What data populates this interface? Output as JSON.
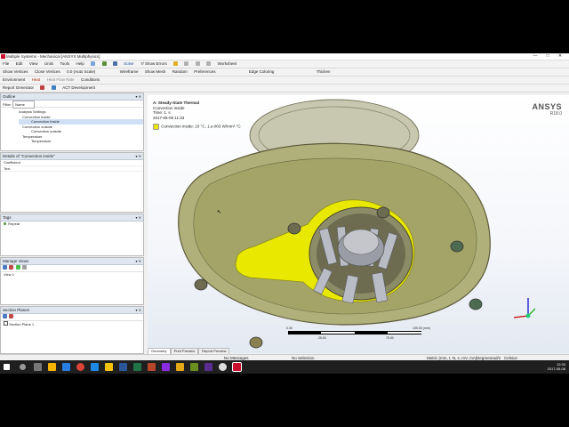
{
  "window": {
    "title": "Multiple Systems - Mechanical [ANSYS Multiphysics]",
    "controls": [
      "—",
      "□",
      "✕"
    ]
  },
  "menubar": {
    "items": [
      "File",
      "Edit",
      "View",
      "Units",
      "Tools",
      "Help"
    ],
    "solve_label": "Solve",
    "show_errors_label": "?/ Show Errors",
    "worksheet_label": "Worksheet"
  },
  "toolbar2": {
    "items": [
      "Show Vertices",
      "Close Vertices",
      "0.0 (Auto Scale)",
      "Wireframe",
      "Show Mesh",
      "Random",
      "Preferences",
      "Edge Coloring",
      "Thicken"
    ]
  },
  "toolbar3": {
    "environment_label": "Environment",
    "heat_label": "Heat",
    "heat_flow_label": "Heat Flow Rate",
    "conditions_label": "Conditions"
  },
  "toolbar4": {
    "report_label": "Report Generator",
    "act_label": "ACT Development"
  },
  "outline": {
    "title": "Outline",
    "filter_label": "Filter:",
    "filter_value": "Name",
    "tree": [
      "Analysis Settings",
      "Convection inside",
      "Convection Inside",
      "Convection outside",
      "Convection outside",
      "Temperature",
      "Temperature"
    ]
  },
  "details": {
    "title": "Details of \"Convection inside\"",
    "rows": [
      "Coefficient",
      "Text"
    ]
  },
  "tags": {
    "title": "Tags",
    "items": [
      "Repeat"
    ]
  },
  "manage_views": {
    "title": "Manage Views",
    "items": [
      "View 1"
    ]
  },
  "section_planes": {
    "title": "Section Planes",
    "items": [
      "Section Plane 1"
    ]
  },
  "viewport": {
    "analysis_title": "A: Steady-State Thermal",
    "load_name": "Convection inside",
    "time_label": "Time: 1. s",
    "date_label": "2017-05-08 11:33",
    "legend_entry": "Convection inside: 10 °C, 1.e-003 W/mm²·°C",
    "legend_color": "#e8e800",
    "logo_line1": "ANSYS",
    "logo_line2": "R18.0",
    "scale_left": "0.00",
    "scale_right": "100.00 (mm)",
    "scale_mid1": "25.00",
    "scale_mid2": "75.00"
  },
  "view_tabs": [
    "Geometry",
    "Print Preview",
    "Report Preview"
  ],
  "statusbar": {
    "messages": "No Messages",
    "selection": "No Selection",
    "units": "Metric (mm, t, N, s, mV, mA)",
    "degrees": "Degrees",
    "rads": "rad/s",
    "temp": "Celsius"
  },
  "taskbar": {
    "time": "12:33",
    "date": "2017-05-08"
  }
}
